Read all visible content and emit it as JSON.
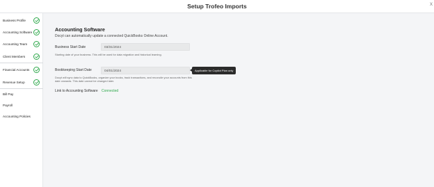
{
  "header": {
    "title": "Setup Trofeo Imports",
    "close_glyph": "x"
  },
  "sidebar": {
    "items": [
      {
        "label": "Business Profile",
        "completed": true,
        "active": false
      },
      {
        "label": "Accounting Software",
        "completed": true,
        "active": true
      },
      {
        "label": "Accounting Team",
        "completed": true,
        "active": false
      },
      {
        "label": "Client Members",
        "completed": true,
        "active": false
      },
      {
        "label": "Financial Accounts",
        "completed": true,
        "active": false
      },
      {
        "label": "Revenue Setup",
        "completed": true,
        "active": false
      },
      {
        "label": "Bill Pay",
        "completed": false,
        "active": false
      },
      {
        "label": "Payroll",
        "completed": false,
        "active": false
      },
      {
        "label": "Accounting Policies",
        "completed": false,
        "active": false
      }
    ],
    "check_color": "#2ea84b"
  },
  "main": {
    "title": "Accounting Software",
    "subtitle": "Docyt can automatically update a connected QuickBooks Online Account.",
    "business_start": {
      "label": "Business Start Date",
      "value": "03/31/2024",
      "help": "Starting date of your business. This will be used for data migration and historical learning."
    },
    "bookkeeping_start": {
      "label": "Bookkeeping Start Date",
      "value": "04/01/2024",
      "help": "Docyt will sync data to QuickBooks, organize your books, track transactions, and reconcile your accounts from this date onwards. This date cannot be changed later.",
      "tooltip": "Applicable for Copilot Plan only"
    },
    "link": {
      "label": "Link to Accounting Software",
      "status": "Connected",
      "status_color": "#2ea84b"
    }
  }
}
